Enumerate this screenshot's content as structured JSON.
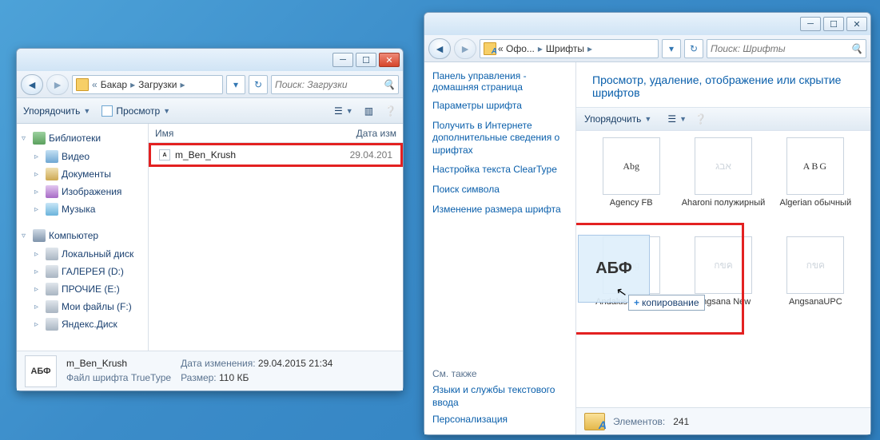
{
  "win1": {
    "breadcrumb": [
      "Бакар",
      "Загрузки"
    ],
    "search_placeholder": "Поиск: Загрузки",
    "toolbar": {
      "organize": "Упорядочить",
      "preview": "Просмотр"
    },
    "tree": {
      "libraries": "Библиотеки",
      "video": "Видео",
      "documents": "Документы",
      "images": "Изображения",
      "music": "Музыка",
      "computer": "Компьютер",
      "drives": [
        "Локальный диск",
        "ГАЛЕРЕЯ (D:)",
        "ПРОЧИЕ (E:)",
        "Мои файлы (F:)",
        "Яндекс.Диск"
      ]
    },
    "columns": {
      "name": "Имя",
      "date": "Дата изм"
    },
    "file": {
      "name": "m_Ben_Krush",
      "date": "29.04.201"
    },
    "details": {
      "thumb": "АБФ",
      "name": "m_Ben_Krush",
      "type": "Файл шрифта TrueType",
      "mod_label": "Дата изменения:",
      "mod_val": "29.04.2015 21:34",
      "size_label": "Размер:",
      "size_val": "110 КБ"
    }
  },
  "win2": {
    "breadcrumb_prefix": "« Офо...",
    "breadcrumb_seg": "Шрифты",
    "search_placeholder": "Поиск: Шрифты",
    "side": {
      "home": "Панель управления - домашняя страница",
      "links": [
        "Параметры шрифта",
        "Получить в Интернете дополнительные сведения о шрифтах",
        "Настройка текста ClearType",
        "Поиск символа",
        "Изменение размера шрифта"
      ],
      "also": "См. также",
      "also_links": [
        "Языки и службы текстового ввода",
        "Персонализация"
      ]
    },
    "heading": "Просмотр, удаление, отображение или скрытие шрифтов",
    "toolbar": {
      "organize": "Упорядочить"
    },
    "fonts": [
      {
        "preview": "Abg",
        "label": "Agency FB",
        "dim": false
      },
      {
        "preview": "אבג",
        "label": "Aharoni полужирный",
        "dim": true
      },
      {
        "preview": "ABG",
        "label": "Algerian обычный",
        "dim": false
      },
      {
        "preview": "Abg",
        "label": "Andalus обычный",
        "dim": true
      },
      {
        "preview": "กขค",
        "label": "Angsana New",
        "dim": true
      },
      {
        "preview": "กขค",
        "label": "AngsanaUPC",
        "dim": true
      }
    ],
    "drag_preview": "АБФ",
    "drag_tooltip": "копирование",
    "status": {
      "label": "Элементов:",
      "count": "241"
    }
  }
}
